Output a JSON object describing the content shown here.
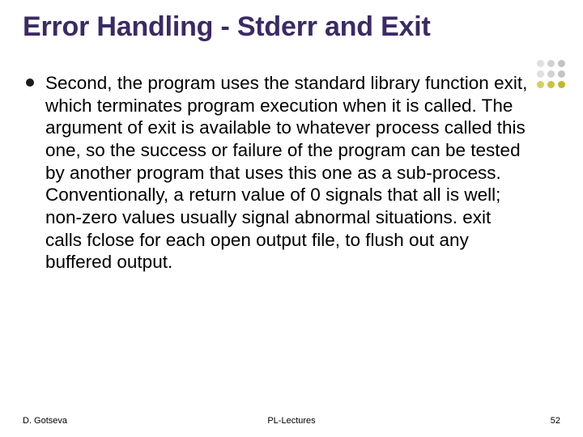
{
  "title": "Error Handling - Stderr and Exit",
  "bullet": {
    "text": "Second, the program uses the standard library function exit, which terminates program execution when it is called. The argument of exit is available to whatever process called this one, so the success or failure of the program can be tested by another program that uses this one as a sub-process. Conventionally, a return value of 0 signals that all is well; non-zero values usually signal abnormal situations. exit calls fclose for each open output file, to flush out any buffered output."
  },
  "footer": {
    "author": "D. Gotseva",
    "center": "PL-Lectures",
    "page": "52"
  }
}
